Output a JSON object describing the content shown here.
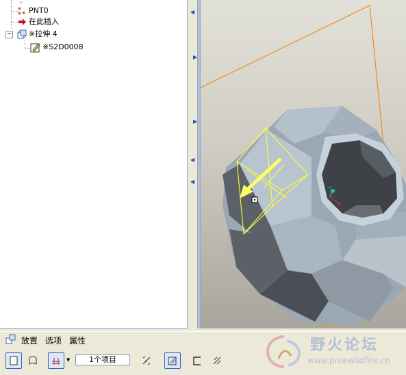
{
  "tree": {
    "items": [
      {
        "label": "PNT0",
        "icon": "datum-point-icon"
      },
      {
        "label": "在此插入",
        "icon": "insert-here-arrow-icon"
      },
      {
        "label": "※拉伸 4",
        "icon": "extrude-feature-icon",
        "expander": "⊟"
      },
      {
        "label": "※S2D0008",
        "icon": "sketch-icon"
      }
    ]
  },
  "dashboard": {
    "tabs": [
      "放置",
      "选项",
      "属性"
    ],
    "depth_value": "1个项目",
    "tools": [
      "solid-extrude-icon",
      "surface-extrude-icon",
      "depth-options-icon",
      "depth-dropdown-icon",
      "flip-direction-icon",
      "remove-material-icon",
      "thicken-sketch-icon",
      "flip-material-side-icon"
    ]
  },
  "watermark": {
    "name": "野火论坛",
    "url": "www.proewildfire.cn"
  },
  "colors": {
    "datum_plane": "#f08a1c",
    "preview": "#ffff33",
    "model": "#9aa7b4"
  }
}
